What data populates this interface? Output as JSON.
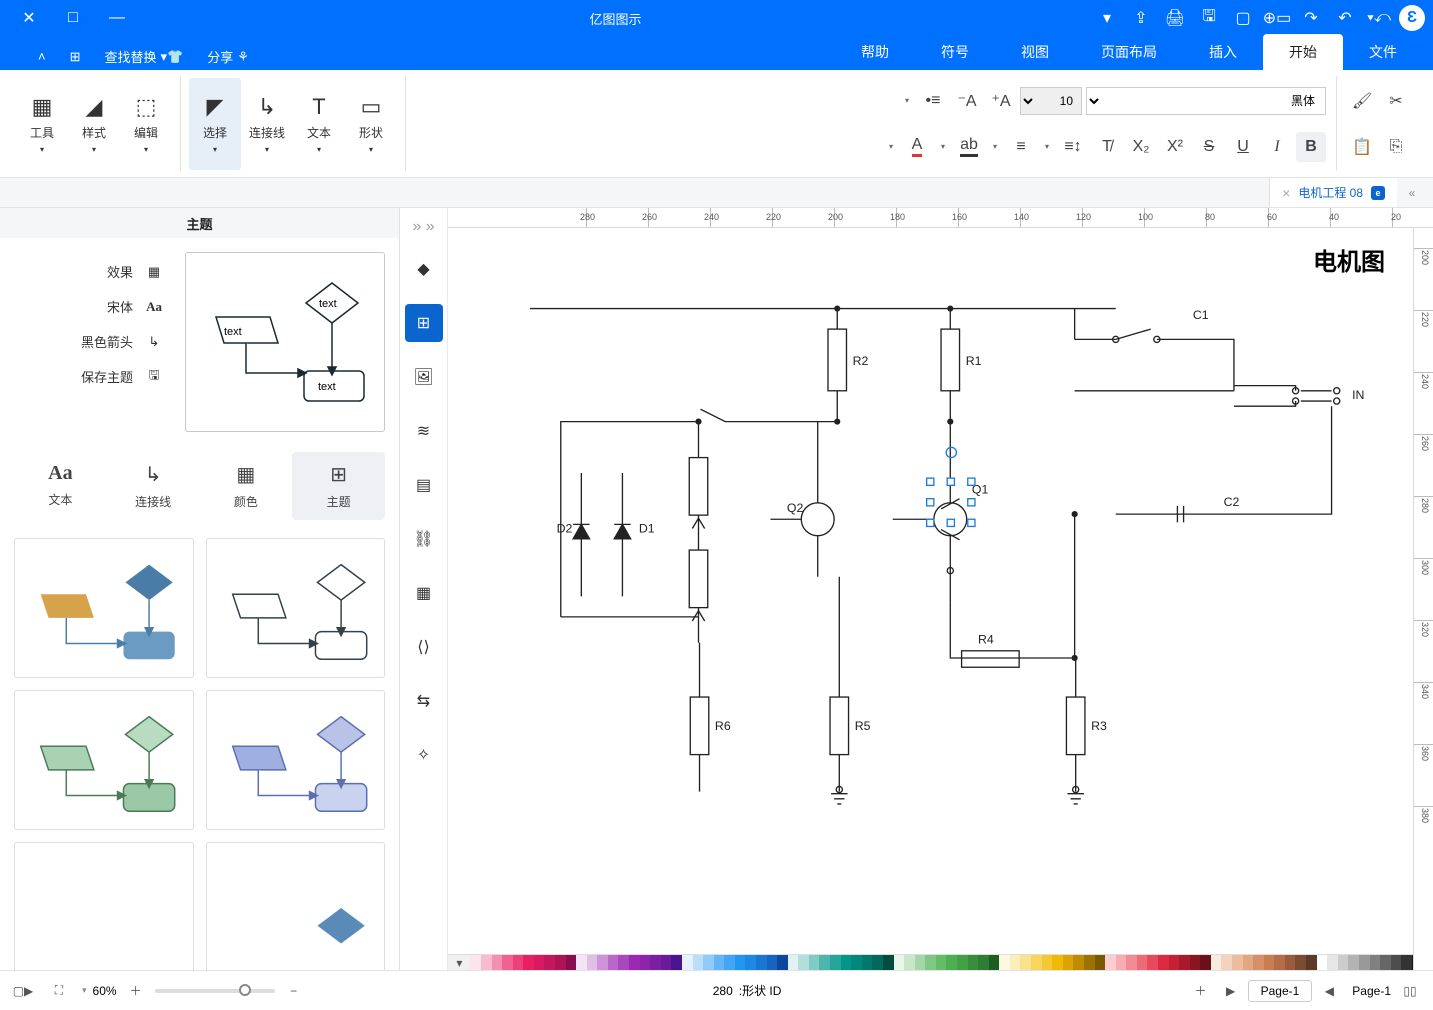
{
  "app": {
    "title": "亿图图示",
    "tabs": [
      "文件",
      "开始",
      "插入",
      "页面布局",
      "视图",
      "符号",
      "帮助"
    ],
    "active_tab_index": 1,
    "extras": {
      "share": "分享",
      "find_replace": "查找替换"
    }
  },
  "font": {
    "family": "黑体",
    "size": "10"
  },
  "ribbon": {
    "cut": "剪切",
    "copy": "复制",
    "paste": "粘贴",
    "shape": "形状",
    "text": "文本",
    "connector": "连接线",
    "select": "选择",
    "edit": "编辑",
    "style": "样式",
    "tool": "工具"
  },
  "doc_tab": {
    "name": "电机工程 08"
  },
  "canvas": {
    "title": "电机图",
    "shape_id_label": "形状 ID:",
    "shape_id": "280"
  },
  "labels": {
    "IN": "IN",
    "C1": "C1",
    "C2": "C2",
    "R1": "R1",
    "R2": "R2",
    "R3": "R3",
    "R4": "R4",
    "R5": "R5",
    "R6": "R6",
    "Q1": "Q1",
    "Q2": "Q2",
    "D1": "D1",
    "D2": "D2"
  },
  "theme_panel": {
    "title": "主题",
    "props": {
      "effect": "效果",
      "font": "宋体",
      "connector": "黑色箭头",
      "save": "保存主题"
    },
    "tabs": [
      "主题",
      "颜色",
      "连接线",
      "文本"
    ],
    "active_tab": 0,
    "preview_text": "text"
  },
  "status": {
    "page_label": "Page-1",
    "page_tab": "Page-1",
    "zoom": "60%"
  },
  "ruler_h": [
    20,
    40,
    60,
    80,
    100,
    120,
    140,
    160,
    180,
    200,
    220,
    240,
    260,
    280
  ],
  "ruler_v": [
    200,
    220,
    240,
    260,
    280,
    300,
    320,
    340,
    360,
    380
  ],
  "colors": [
    "#000000",
    "#1a1a1a",
    "#333333",
    "#4d4d4d",
    "#666666",
    "#808080",
    "#999999",
    "#b3b3b3",
    "#cccccc",
    "#e6e6e6",
    "#ffffff",
    "#5b3a29",
    "#7b4b33",
    "#9b5c3e",
    "#b36d48",
    "#c77e52",
    "#d69067",
    "#e3a681",
    "#edbc9d",
    "#f4d3bc",
    "#fae9dd",
    "#6b0f1a",
    "#8b1423",
    "#a91a2c",
    "#c62035",
    "#de2a41",
    "#e74a5d",
    "#ed6a79",
    "#f28a95",
    "#f7abb2",
    "#fbcdd1",
    "#7a5901",
    "#9c7302",
    "#be8c03",
    "#dba404",
    "#f0b905",
    "#f4c733",
    "#f7d55f",
    "#fae28c",
    "#fceeb8",
    "#fef8e1",
    "#1b5e20",
    "#2e7d32",
    "#388e3c",
    "#43a047",
    "#4caf50",
    "#66bb6a",
    "#81c784",
    "#a5d6a7",
    "#c8e6c9",
    "#e8f5e9",
    "#004d40",
    "#00695c",
    "#00796b",
    "#00897b",
    "#009688",
    "#26a69a",
    "#4db6ac",
    "#80cbc4",
    "#b2dfdb",
    "#e0f2f1",
    "#0d47a1",
    "#1565c0",
    "#1976d2",
    "#1e88e5",
    "#2196f3",
    "#42a5f5",
    "#64b5f6",
    "#90caf9",
    "#bbdefb",
    "#e3f2fd",
    "#4a148c",
    "#6a1b9a",
    "#7b1fa2",
    "#8e24aa",
    "#9c27b0",
    "#ab47bc",
    "#ba68c8",
    "#ce93d8",
    "#e1bee7",
    "#f3e5f5",
    "#880e4f",
    "#ad1457",
    "#c2185b",
    "#d81b60",
    "#e91e63",
    "#ec407a",
    "#f06292",
    "#f48fb1",
    "#f8bbd0",
    "#fce4ec"
  ]
}
